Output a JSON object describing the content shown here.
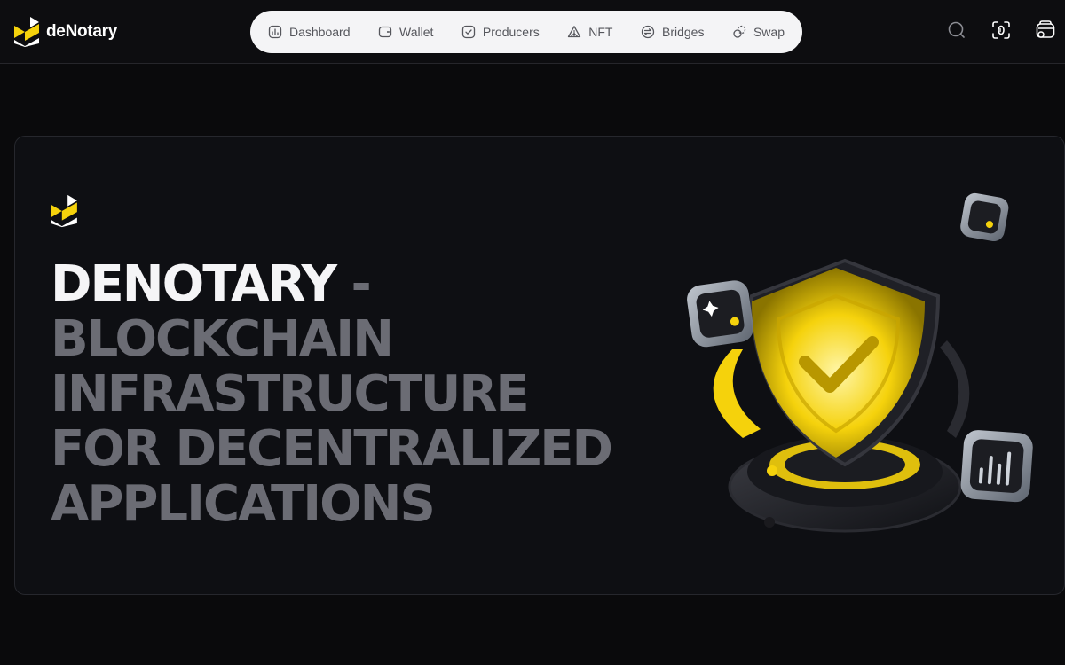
{
  "brand": {
    "name": "deNotary"
  },
  "nav": {
    "items": [
      {
        "label": "Dashboard",
        "icon": "dashboard-icon"
      },
      {
        "label": "Wallet",
        "icon": "wallet-icon"
      },
      {
        "label": "Producers",
        "icon": "producers-icon"
      },
      {
        "label": "NFT",
        "icon": "nft-icon"
      },
      {
        "label": "Bridges",
        "icon": "bridges-icon"
      },
      {
        "label": "Swap",
        "icon": "swap-icon"
      }
    ]
  },
  "toolbar": {
    "icons": [
      "search-icon",
      "scan-icon",
      "wallet-connect-icon"
    ]
  },
  "hero": {
    "headline_main": "DENOTARY",
    "headline_sub": " - BLOCKCHAIN INFRASTRUCTURE FOR DECENTRALIZED APPLICATIONS"
  },
  "colors": {
    "accent": "#f5d20c",
    "background": "#0a0a0c",
    "nav_bg": "#f4f4f6",
    "headline_muted": "#6b6c74"
  }
}
